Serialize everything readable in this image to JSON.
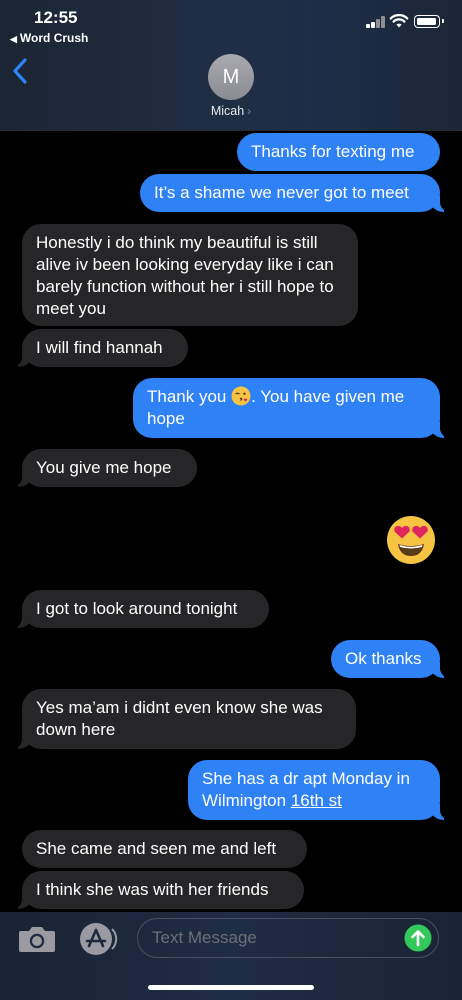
{
  "status_bar": {
    "time": "12:55",
    "back_app": "Word Crush"
  },
  "contact": {
    "initial": "M",
    "name": "Micah"
  },
  "messages": [
    {
      "dir": "out",
      "text": "Thanks for texting me"
    },
    {
      "dir": "out",
      "text": "It’s a shame we never got to meet"
    },
    {
      "dir": "in",
      "text": "Honestly i do think my beautiful is still alive iv been looking everyday like i can barely function without her i still hope to meet you"
    },
    {
      "dir": "in",
      "text": "I will find hannah"
    },
    {
      "dir": "out",
      "text_before": "Thank you",
      "emoji": "kissing-face-emoji",
      "text_after": ". You have given me hope"
    },
    {
      "dir": "in",
      "text": "You give me hope"
    },
    {
      "dir": "out",
      "emoji": "heart-eyes-emoji"
    },
    {
      "dir": "in",
      "text": "I got to look around tonight"
    },
    {
      "dir": "out",
      "text": "Ok thanks"
    },
    {
      "dir": "in",
      "text": "Yes ma’am i didnt even know she was down here"
    },
    {
      "dir": "out",
      "text_before": "She has a dr apt Monday in Wilmington ",
      "link": "16th st"
    },
    {
      "dir": "in",
      "text": "She came and seen me and left"
    },
    {
      "dir": "in",
      "text": "I think she was with her friends"
    }
  ],
  "composer": {
    "placeholder": "Text Message"
  },
  "colors": {
    "outgoing": "#2f82f6",
    "incoming": "#262629",
    "send": "#34c759"
  }
}
